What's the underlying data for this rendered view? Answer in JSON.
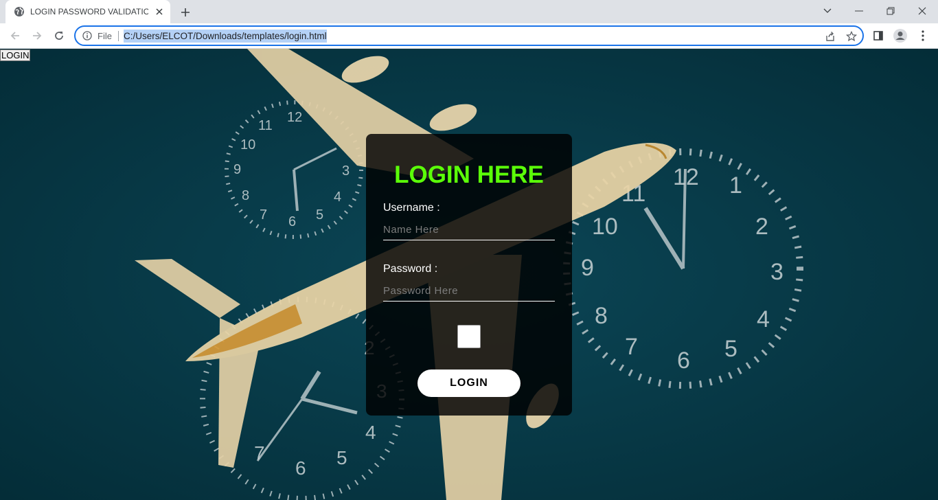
{
  "browser": {
    "tab_title": "LOGIN PASSWORD VALIDATION",
    "file_label": "File",
    "url": "C:/Users/ELCOT/Downloads/templates/login.html"
  },
  "page": {
    "nav_button": "LOGIN",
    "login_form": {
      "title": "LOGIN HERE",
      "username_label": "Username :",
      "username_placeholder": "Name Here",
      "password_label": "Password :",
      "password_placeholder": "Password Here",
      "submit_label": "LOGIN"
    }
  },
  "colors": {
    "title_green": "#5bff08",
    "background_teal": "#063440",
    "url_selection": "#b4d1f6",
    "omnibox_focus": "#1a73e8"
  },
  "icons": [
    "globe-icon",
    "close-icon",
    "plus-icon",
    "chevron-down-icon",
    "minimize-icon",
    "restore-icon",
    "window-close-icon",
    "back-arrow-icon",
    "forward-arrow-icon",
    "reload-icon",
    "info-icon",
    "share-icon",
    "star-icon",
    "side-panel-icon",
    "profile-icon",
    "menu-icon"
  ]
}
